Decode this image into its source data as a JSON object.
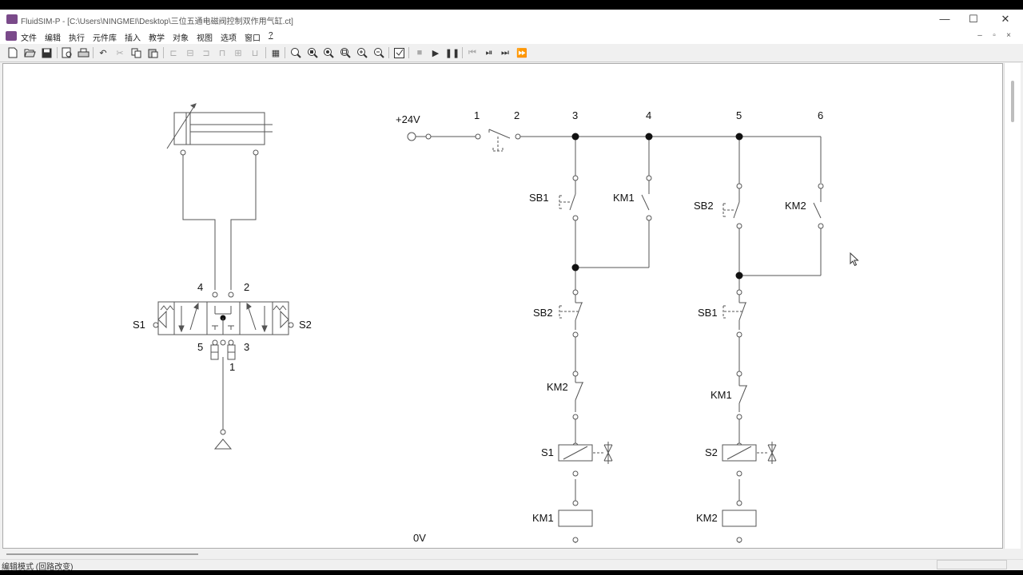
{
  "window": {
    "title": "FluidSIM-P - [C:\\Users\\NINGMEI\\Desktop\\三位五通电磁阀控制双作用气缸.ct]",
    "minimize": "—",
    "maximize": "☐",
    "close": "✕"
  },
  "menu": {
    "items": [
      "文件",
      "编辑",
      "执行",
      "元件库",
      "插入",
      "教学",
      "对象",
      "视图",
      "选项",
      "窗口",
      "?"
    ],
    "mdi": [
      "–",
      "▫",
      "×"
    ]
  },
  "circuit": {
    "supply_label": "+24V",
    "ground_label": "0V",
    "node_labels": [
      "1",
      "2",
      "3",
      "4",
      "5",
      "6"
    ],
    "rung1": {
      "start_button": "SB1",
      "hold_contact": "KM1",
      "stop_button": "SB2",
      "interlock": "KM2",
      "solenoid": "S1",
      "relay_coil": "KM1"
    },
    "rung2": {
      "start_button": "SB2",
      "hold_contact": "KM2",
      "stop_button": "SB1",
      "interlock": "KM1",
      "solenoid": "S2",
      "relay_coil": "KM2"
    },
    "valve": {
      "solenoid_left": "S1",
      "solenoid_right": "S2",
      "port_a": "4",
      "port_b": "2",
      "exhaust_a": "5",
      "exhaust_b": "3",
      "supply": "1"
    }
  },
  "status": {
    "mode": "编辑模式 (回路改变)"
  }
}
